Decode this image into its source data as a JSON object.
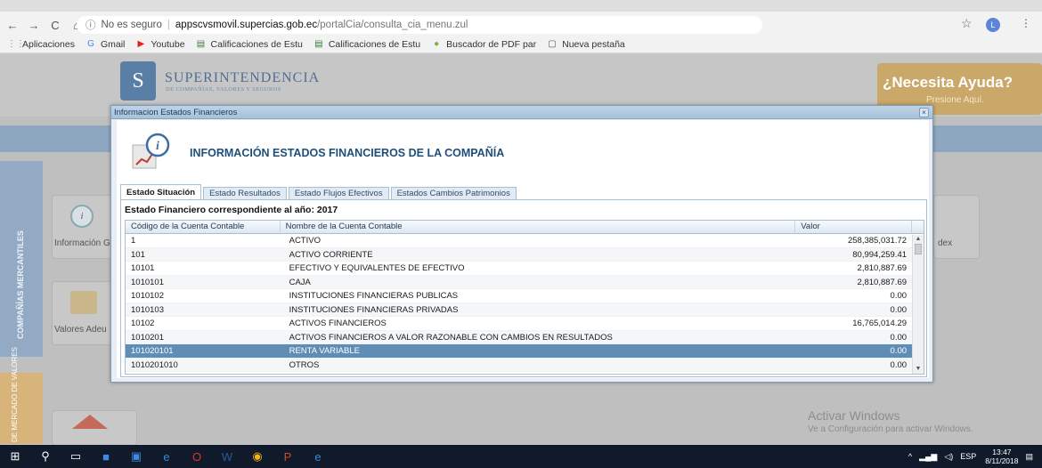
{
  "browser": {
    "url_security": "No es seguro",
    "url_host": "appscvsmovil.supercias.gob.ec",
    "url_path": "/portalCia/consulta_cia_menu.zul",
    "profile_initial": "L"
  },
  "bookmarks": [
    {
      "icon": "apps-grid-icon",
      "glyph": "⋮⋮",
      "label": "Aplicaciones",
      "color": "#4285f4"
    },
    {
      "icon": "google-icon",
      "glyph": "G",
      "label": "Gmail",
      "color": "#4285f4"
    },
    {
      "icon": "youtube-icon",
      "glyph": "▶",
      "label": "Youtube",
      "color": "#e62117"
    },
    {
      "icon": "site-icon",
      "glyph": "▤",
      "label": "Calificaciones de Estu",
      "color": "#3a7a3a"
    },
    {
      "icon": "site-icon",
      "glyph": "▤",
      "label": "Calificaciones de Estu",
      "color": "#3a7a3a"
    },
    {
      "icon": "globe-icon",
      "glyph": "●",
      "label": "Buscador de PDF par",
      "color": "#7cb342"
    },
    {
      "icon": "page-icon",
      "glyph": "▢",
      "label": "Nueva pestaña",
      "color": "#555555"
    }
  ],
  "site": {
    "logo_name": "SUPERINTENDENCIA",
    "logo_sub": "DE COMPAÑÍAS, VALORES Y SEGUROS",
    "help_title": "¿Necesita Ayuda?",
    "help_sub": "Presione Aquí.",
    "sidebar_label": "COMPAÑÍAS MERCANTILES",
    "sidebar2_label": "DE MERCADO DE VALORES",
    "card1_label": "Información G",
    "card2_label": "Valores Adeu",
    "card3_label": "dex",
    "activate_title": "Activar Windows",
    "activate_sub": "Ve a Configuración para activar Windows."
  },
  "dialog": {
    "title": "Informacion Estados Financieros",
    "close_glyph": "×",
    "heading": "INFORMACIÓN ESTADOS FINANCIEROS DE LA COMPAÑÍA",
    "tabs": [
      {
        "label": "Estado Situación",
        "active": true
      },
      {
        "label": "Estado Resultados",
        "active": false
      },
      {
        "label": "Estado Flujos Efectivos",
        "active": false
      },
      {
        "label": "Estados Cambios Patrimonios",
        "active": false
      }
    ],
    "year_label": "Estado Financiero correspondiente al año: 2017",
    "columns": [
      "Código de la Cuenta Contable",
      "Nombre de la Cuenta Contable",
      "Valor"
    ],
    "rows": [
      {
        "code": "1",
        "name": "ACTIVO",
        "value": "258,385,031.72"
      },
      {
        "code": "101",
        "name": "ACTIVO CORRIENTE",
        "value": "80,994,259.41"
      },
      {
        "code": "10101",
        "name": "EFECTIVO Y EQUIVALENTES DE EFECTIVO",
        "value": "2,810,887.69"
      },
      {
        "code": "1010101",
        "name": "CAJA",
        "value": "2,810,887.69"
      },
      {
        "code": "1010102",
        "name": "INSTITUCIONES FINANCIERAS PUBLICAS",
        "value": "0.00"
      },
      {
        "code": "1010103",
        "name": "INSTITUCIONES FINANCIERAS PRIVADAS",
        "value": "0.00"
      },
      {
        "code": "10102",
        "name": "ACTIVOS FINANCIEROS",
        "value": "16,765,014.29"
      },
      {
        "code": "1010201",
        "name": "ACTIVOS FINANCIEROS A VALOR RAZONABLE CON CAMBIOS EN RESULTADOS",
        "value": "0.00"
      },
      {
        "code": "101020101",
        "name": "RENTA VARIABLE",
        "value": "0.00",
        "selected": true
      },
      {
        "code": "1010201010",
        "name": "OTROS",
        "value": "0.00"
      }
    ]
  },
  "taskbar": {
    "lang": "ESP",
    "time": "13:47",
    "date": "8/11/2018"
  }
}
